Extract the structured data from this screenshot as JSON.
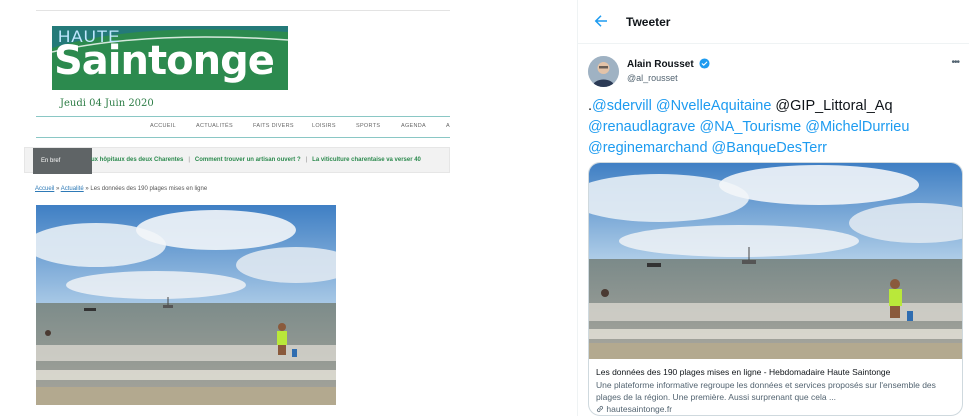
{
  "newspaper": {
    "logo": {
      "line1": "HAUTE",
      "line2": "Saintonge"
    },
    "date": "Jeudi 04 Juin 2020",
    "nav": [
      "ACCUEIL",
      "ACTUALITÉS",
      "FAITS DIVERS",
      "LOISIRS",
      "SPORTS",
      "AGENDA",
      "A"
    ],
    "ticker": {
      "badge": "En bref",
      "items": [
        "ux hôpitaux des deux Charentes",
        "Comment trouver un artisan ouvert ?",
        "La viticulture charentaise va verser 40"
      ]
    },
    "breadcrumb": {
      "home": "Accueil",
      "separator": "»",
      "section": "Actualité",
      "current": "Les données des 190 plages mises en ligne"
    }
  },
  "tweet": {
    "header_title": "Tweeter",
    "author_name": "Alain Rousset",
    "author_handle": "@al_rousset",
    "text_parts": [
      {
        "text": ".",
        "mention": false
      },
      {
        "text": "@sdervill",
        "mention": true
      },
      {
        "text": " ",
        "mention": false
      },
      {
        "text": "@NvelleAquitaine",
        "mention": true
      },
      {
        "text": " @GIP_Littoral_Aq ",
        "mention": false
      },
      {
        "text": "@renaudlagrave",
        "mention": true
      },
      {
        "text": " ",
        "mention": false
      },
      {
        "text": "@NA_Tourisme",
        "mention": true
      },
      {
        "text": " ",
        "mention": false
      },
      {
        "text": "@MichelDurrieu",
        "mention": true
      },
      {
        "text": " ",
        "mention": false
      },
      {
        "text": "@reginemarchand",
        "mention": true
      },
      {
        "text": " ",
        "mention": false
      },
      {
        "text": "@BanqueDesTerr",
        "mention": true
      }
    ],
    "card": {
      "title": "Les données des 190 plages mises en ligne - Hebdomadaire Haute Saintonge",
      "description": "Une plateforme informative regroupe les données et services proposés sur l'ensemble des plages de la région. Une première. Aussi surprenant que cela ...",
      "domain": "hautesaintonge.fr"
    }
  },
  "colors": {
    "brand_green": "#2c8a4e",
    "twitter_blue": "#1d9bf0",
    "text_dark": "#0f1419",
    "text_muted": "#536471"
  },
  "icons": [
    "back-arrow-icon",
    "verified-badge-icon",
    "more-options-icon",
    "link-icon"
  ]
}
